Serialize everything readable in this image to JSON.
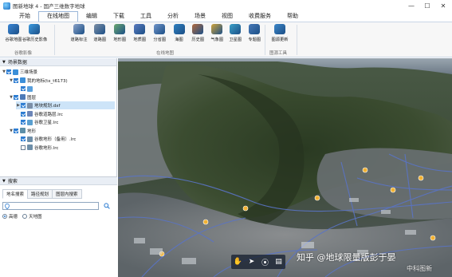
{
  "window": {
    "title": "图新地球 4 - 国产三维数字地球",
    "minimize": "—",
    "maximize": "☐",
    "close": "✕"
  },
  "menu": [
    "开始",
    "在线地图",
    "编辑",
    "下载",
    "工具",
    "分析",
    "场景",
    "视图",
    "收费服务",
    "帮助"
  ],
  "ribbon": {
    "buttons": [
      {
        "label": "谷歌地图",
        "icon": "globe-icon",
        "color": "#3a86d6"
      },
      {
        "label": "谷歌历史影像",
        "icon": "globe-history-icon",
        "color": "#3c9be0"
      },
      {
        "label": "道路标注",
        "icon": "road-label-icon",
        "color": "#8aa2c8"
      },
      {
        "label": "道路图",
        "icon": "road-map-icon",
        "color": "#7c8fa6"
      },
      {
        "label": "地形图",
        "icon": "terrain-icon",
        "color": "#6aa86f"
      },
      {
        "label": "地质图",
        "icon": "geology-icon",
        "color": "#5a7bbf"
      },
      {
        "label": "分省图",
        "icon": "province-icon",
        "color": "#7094c9"
      },
      {
        "label": "海图",
        "icon": "sea-chart-icon",
        "color": "#2f7fc0"
      },
      {
        "label": "历史图",
        "icon": "history-map-icon",
        "color": "#b36a3e"
      },
      {
        "label": "气象图",
        "icon": "weather-icon",
        "color": "#d0a43a"
      },
      {
        "label": "卫星图",
        "icon": "satellite-icon",
        "color": "#3aa0c8"
      },
      {
        "label": "专题图",
        "icon": "theme-map-icon",
        "color": "#4679b8"
      },
      {
        "label": "图源更新",
        "icon": "source-update-icon",
        "color": "#3c86c9"
      }
    ],
    "groups": [
      "谷歌影像",
      "在线地图",
      "图源工具"
    ]
  },
  "scene_panel": {
    "header": "场景数据",
    "tree": [
      {
        "label": "三维场景",
        "level": 0,
        "checked": true,
        "twisty": "▼",
        "icon": "globe-node-icon"
      },
      {
        "label": "我的地标(tx_t6173)",
        "level": 1,
        "checked": true,
        "twisty": "▼",
        "icon": "pin-node-icon"
      },
      {
        "label": "",
        "level": 2,
        "checked": true,
        "twisty": "",
        "icon": "folder-node-icon"
      },
      {
        "label": "图层",
        "level": 1,
        "checked": true,
        "twisty": "▼",
        "icon": "layers-node-icon"
      },
      {
        "label": "地块规划.dxf",
        "level": 2,
        "checked": true,
        "twisty": "▶",
        "icon": "dxf-node-icon",
        "selected": true
      },
      {
        "label": "谷歌道路层.lrc",
        "level": 2,
        "checked": true,
        "twisty": "",
        "icon": "road-node-icon"
      },
      {
        "label": "谷歌卫星.lrc",
        "level": 2,
        "checked": true,
        "twisty": "",
        "icon": "sat-node-icon"
      },
      {
        "label": "地形",
        "level": 1,
        "checked": true,
        "twisty": "▼",
        "icon": "terrain-node-icon"
      },
      {
        "label": "谷歌地形（备用）.lrc",
        "level": 2,
        "checked": true,
        "twisty": "",
        "icon": "terrain-file-icon"
      },
      {
        "label": "谷歌地形.lrc",
        "level": 2,
        "checked": false,
        "twisty": "",
        "icon": "terrain-file-icon"
      }
    ]
  },
  "search_panel": {
    "header": "搜索",
    "tabs": [
      "地名搜索",
      "路径规划",
      "图层内搜索"
    ],
    "input_value": "",
    "options": [
      {
        "label": "高德",
        "selected": true
      },
      {
        "label": "天地图",
        "selected": false
      }
    ]
  },
  "map": {
    "sky_color": "#7f8b96",
    "terrain_color": "#2f3d2a",
    "road_color": "#5a74c6",
    "markers": [
      "#f2b233",
      "#f2b233",
      "#f2b233",
      "#f2b233",
      "#f2b233",
      "#f2b233",
      "#f2b233",
      "#f2b233"
    ]
  },
  "bottom_toolbar": {
    "icons": [
      "hand-icon",
      "pointer-icon",
      "location-icon",
      "measure-icon"
    ]
  },
  "watermark": {
    "text": "知乎 @地球限量版彭于晏",
    "secondary": "中科图新"
  }
}
